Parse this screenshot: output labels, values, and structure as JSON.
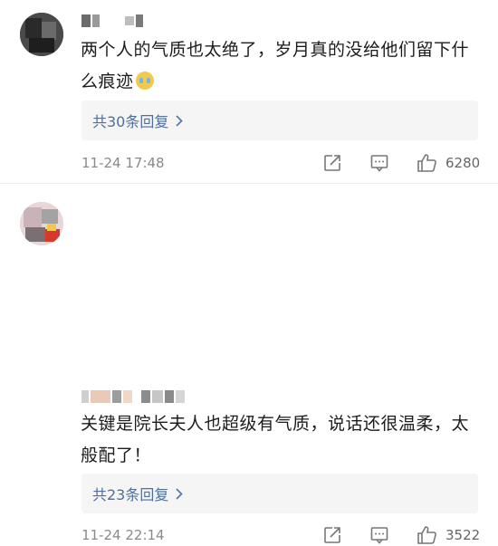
{
  "comments": [
    {
      "text": "两个人的气质也太绝了，岁月真的没给他们留下什么痕迹",
      "emoji_icon": "crying-face-icon",
      "replies_label": "共30条回复",
      "timestamp": "11-24 17:48",
      "likes": "6280"
    },
    {
      "text": "关键是院长夫人也超级有气质，说话还很温柔，太般配了！",
      "replies_label": "共23条回复",
      "timestamp": "11-24 22:14",
      "likes": "3522"
    }
  ],
  "colors": {
    "link": "#4f6e9e",
    "meta": "#8a8a8a",
    "reply_bg": "#f5f5f5"
  },
  "icons": [
    "share-icon",
    "comment-icon",
    "thumbs-up-icon",
    "chevron-right-icon"
  ]
}
